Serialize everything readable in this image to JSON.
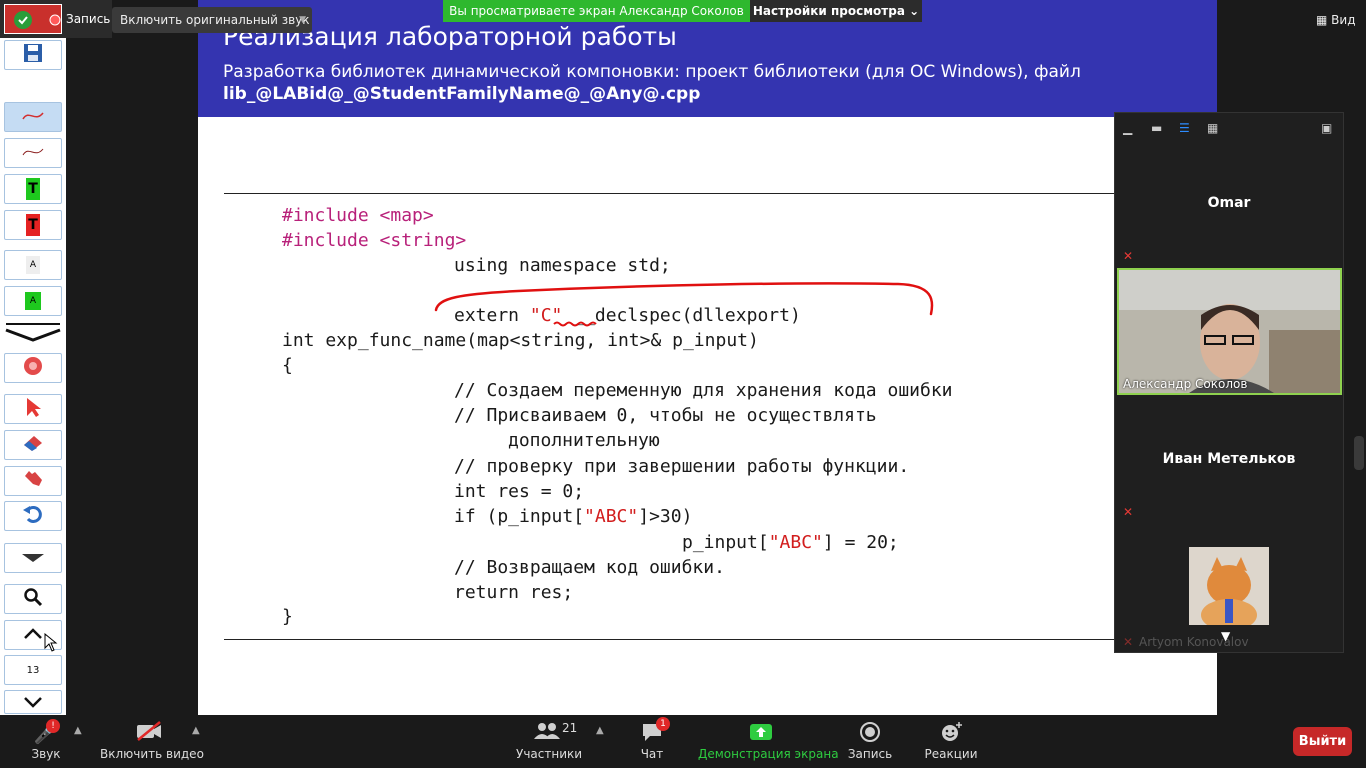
{
  "top": {
    "record_label": "Запись",
    "original_sound": "Включить оригинальный звук",
    "viewing_banner": "Вы просматриваете экран Александр Соколов",
    "view_settings": "Настройки просмотра",
    "view_mode": "Вид"
  },
  "slide": {
    "title": "Реализация лабораторной работы",
    "subtitle": "Разработка библиотек динамической компоновки: проект библиотеки (для ОС Windows), файл",
    "filename": "lib_@LABid@_@StudentFamilyName@_@Any@.cpp",
    "code": {
      "line1_kw": "#include",
      "line1_arg": "<map>",
      "line2_kw": "#include",
      "line2_arg": "<string>",
      "line3": "using namespace std;",
      "line4_a": "extern ",
      "line4_str": "\"C\"",
      "line4_b": " __declspec(dllexport)",
      "line5": "int exp_func_name(map<string, int>& p_input)",
      "line6": "{",
      "line7": "// Создаем переменную для хранения кода ошибки",
      "line8": "// Присваиваем 0, чтобы не осуществлять",
      "line9": "дополнительную",
      "line10": "// проверку при завершении работы функции.",
      "line11": "int res = 0;",
      "line12_a": "if (p_input[",
      "line12_str": "\"ABC\"",
      "line12_b": "]>30)",
      "line13_a": "p_input[",
      "line13_str": "\"ABC\"",
      "line13_b": "] = 20;",
      "line14": "// Возвращаем код ошибки.",
      "line15": "return res;",
      "line16": "}"
    }
  },
  "toolbar": {
    "text_tool_label": "T",
    "zoom_level": "13",
    "icons": [
      "save-icon",
      "pen-icon",
      "pen-thin-icon",
      "text-green-icon",
      "text-red-icon",
      "highlight-a-icon",
      "highlight-a-green-icon",
      "collapse-icon",
      "record-icon",
      "pointer-icon",
      "eraser-icon",
      "hand-icon",
      "undo-icon",
      "dropdown-icon",
      "zoom-icon",
      "scroll-up-icon",
      "scroll-down-icon"
    ]
  },
  "video_panel": {
    "participants": [
      {
        "name": "Omar",
        "muted": true
      },
      {
        "name": "Александр Соколов",
        "video": true
      },
      {
        "name": "Иван Метельков",
        "muted": true
      },
      {
        "name": "Artyom Konovalov",
        "muted": true
      }
    ]
  },
  "bottom": {
    "audio": "Звук",
    "audio_badge": "!",
    "video": "Включить видео",
    "participants": "Участники",
    "participants_count": "21",
    "chat": "Чат",
    "chat_badge": "1",
    "share": "Демонстрация экрана",
    "record": "Запись",
    "reactions": "Реакции",
    "leave": "Выйти"
  },
  "colors": {
    "slide_header": "#3434b0",
    "viewing_banner": "#2eb82e",
    "leave": "#c62828",
    "preprocessor": "#b8217a",
    "string": "#d21d1d",
    "annotation": "#e01010"
  }
}
